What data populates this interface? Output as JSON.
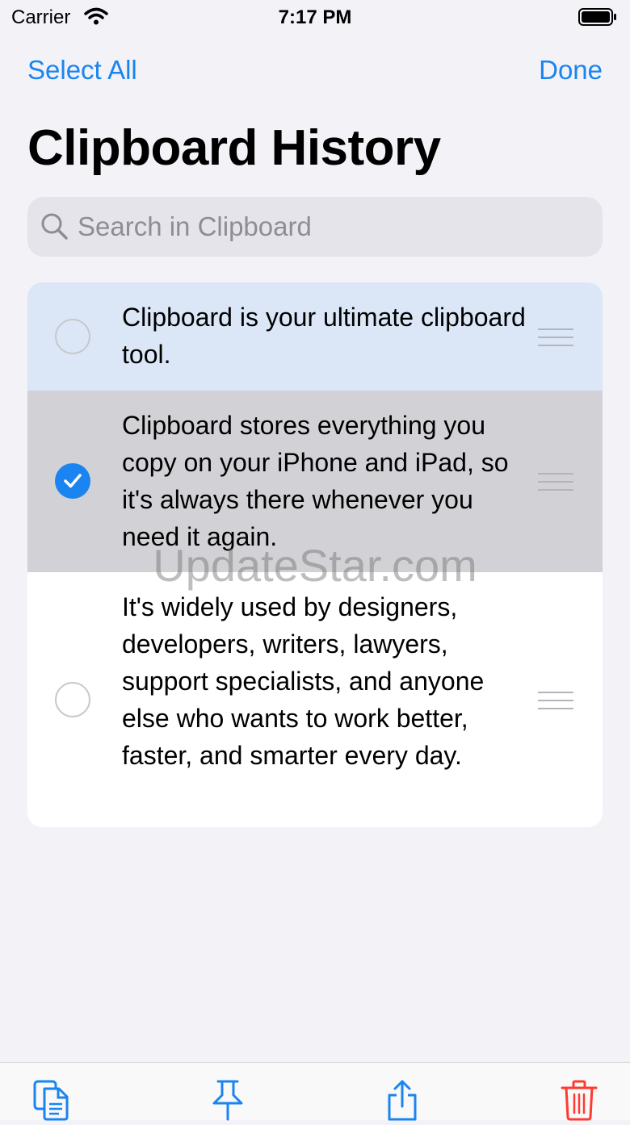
{
  "status_bar": {
    "carrier": "Carrier",
    "time": "7:17 PM"
  },
  "nav": {
    "select_all_label": "Select All",
    "done_label": "Done"
  },
  "page_title": "Clipboard History",
  "search": {
    "placeholder": "Search in Clipboard",
    "value": ""
  },
  "clipboard_items": [
    {
      "text": "Clipboard is your ultimate clipboard tool.",
      "selected": false
    },
    {
      "text": "Clipboard stores everything you copy on your iPhone and iPad, so it's always there whenever you need it again.",
      "selected": true
    },
    {
      "text": "It's widely used by designers, developers, writers, lawyers, support specialists, and anyone else who wants to work better, faster, and smarter every day.",
      "selected": false
    }
  ],
  "watermark": "UpdateStar.com",
  "toolbar": {
    "icons": [
      "copy-icon",
      "pin-icon",
      "share-icon",
      "trash-icon"
    ]
  },
  "colors": {
    "accent": "#1a84f0",
    "destructive": "#ff3b30",
    "background": "#f2f2f7",
    "selected_row": "#d2d2d6",
    "highlight_row": "#dbe7f7"
  }
}
